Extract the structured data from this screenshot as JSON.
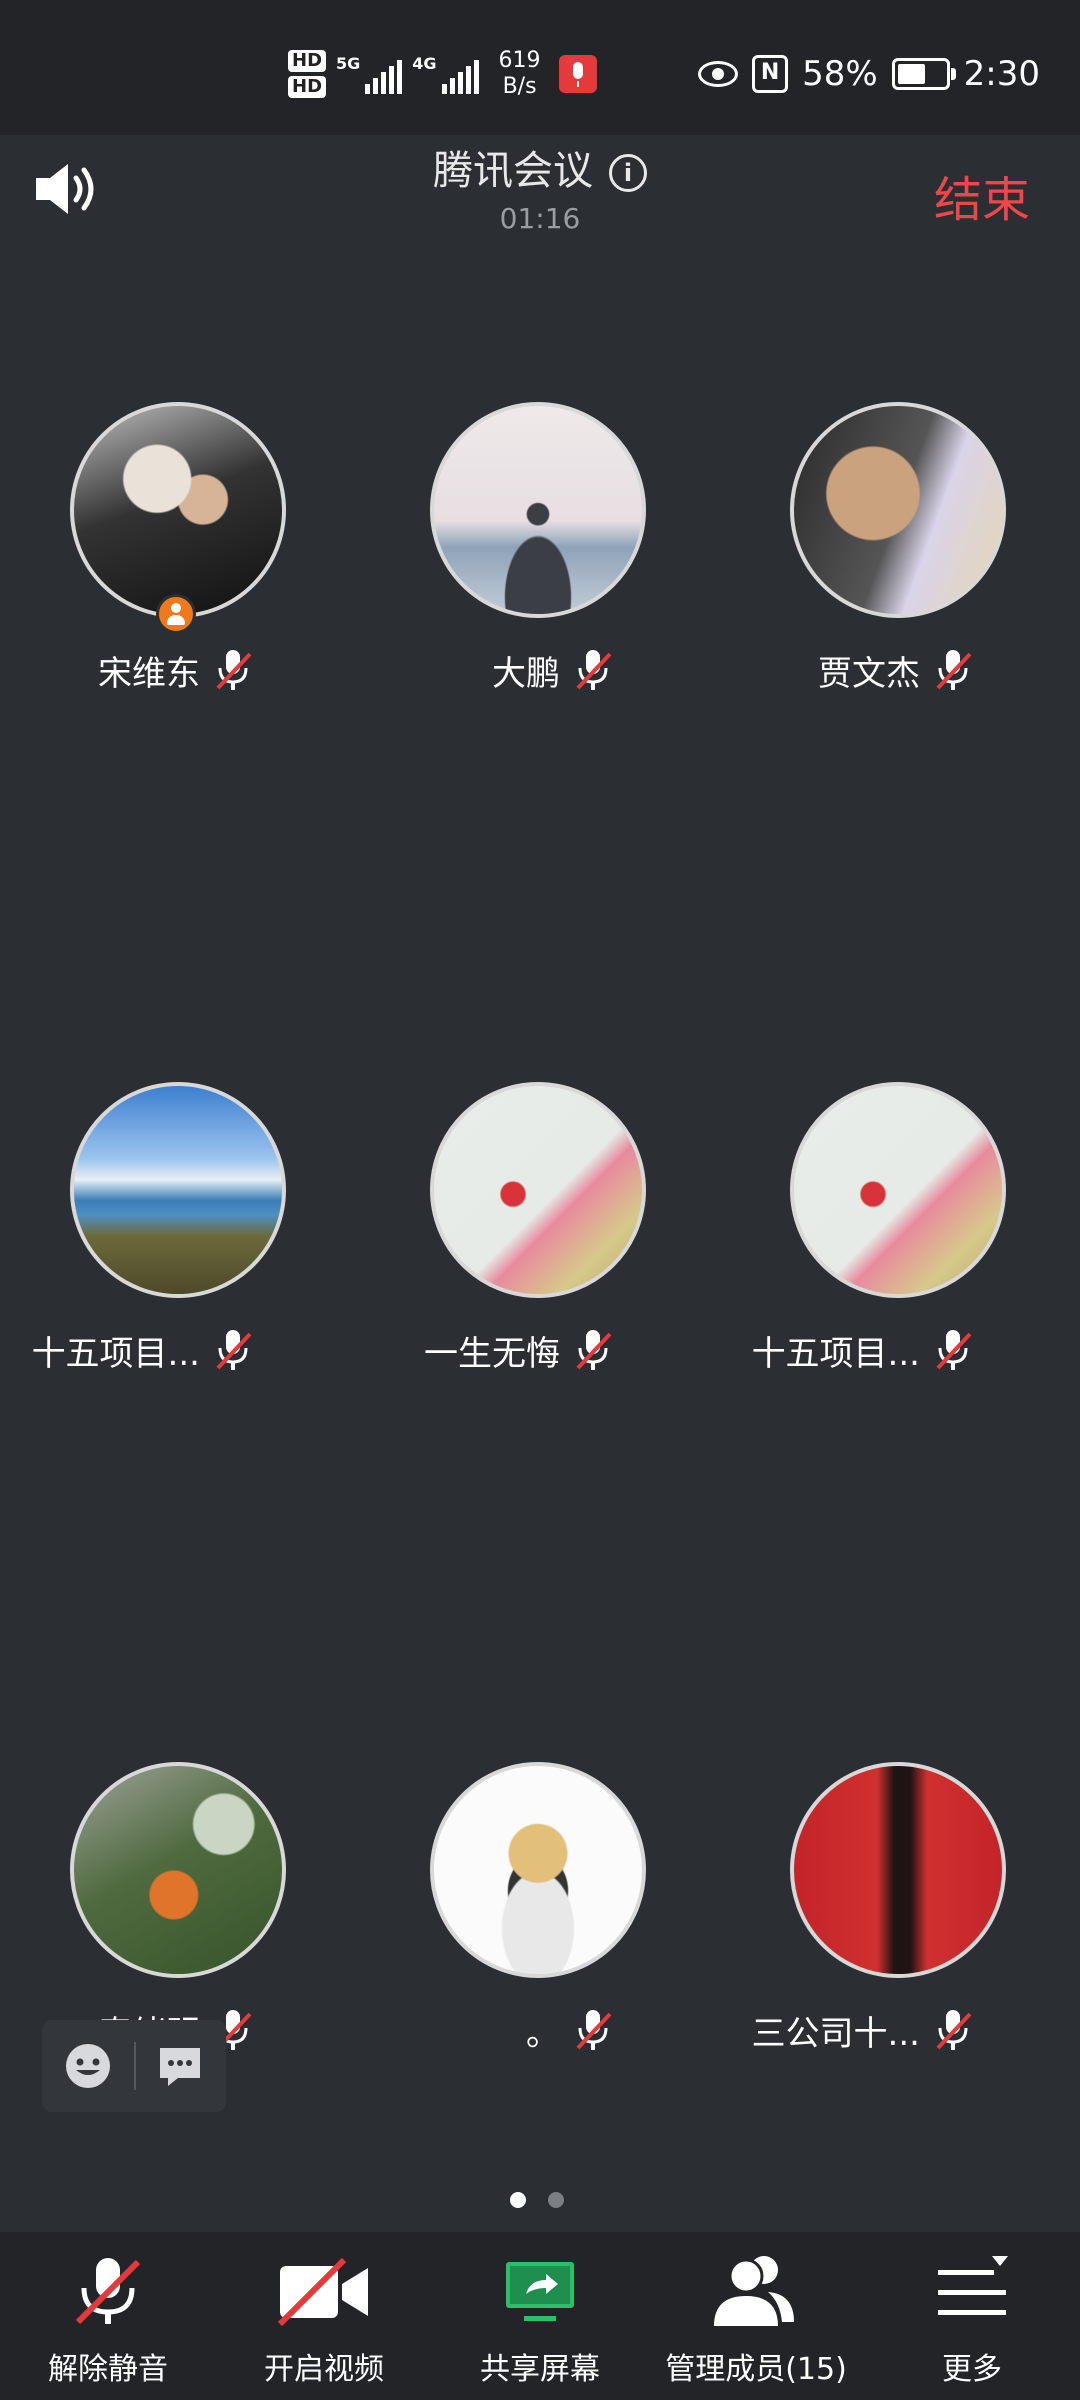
{
  "status_bar": {
    "hd1": "HD",
    "hd2": "HD",
    "sig1_label": "5G",
    "sig2_label": "4G",
    "net_speed_value": "619",
    "net_speed_unit": "B/s",
    "battery_text": "58%",
    "battery_level": 0.58,
    "time": "2:30"
  },
  "header": {
    "title": "腾讯会议",
    "timer": "01:16",
    "end_label": "结束"
  },
  "participants": [
    {
      "name": "宋维东",
      "muted": true,
      "host": true
    },
    {
      "name": "大鹏",
      "muted": true
    },
    {
      "name": "贾文杰",
      "muted": true
    },
    {
      "name": "十五项目...",
      "muted": true
    },
    {
      "name": "一生无悔",
      "muted": true
    },
    {
      "name": "十五项目...",
      "muted": true
    },
    {
      "name": "秦绪明",
      "muted": true
    },
    {
      "name": "。",
      "muted": true
    },
    {
      "name": "三公司十...",
      "muted": true
    }
  ],
  "pagination": {
    "pages": 2,
    "current": 1
  },
  "toolbar": {
    "unmute": "解除静音",
    "video": "开启视频",
    "share": "共享屏幕",
    "members": "管理成员(15)",
    "more": "更多"
  },
  "colors": {
    "background": "#2b2e33",
    "bar": "#222427",
    "end_red": "#f0464b",
    "mute_red": "#e5393b",
    "share_green": "#2bbf6a",
    "host_badge": "#f07a1a"
  }
}
